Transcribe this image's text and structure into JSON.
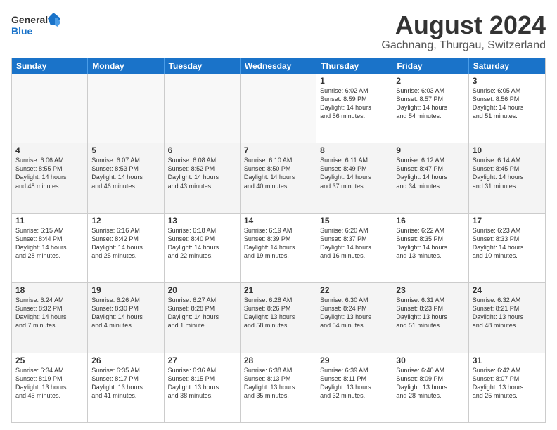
{
  "logo": {
    "line1": "General",
    "line2": "Blue"
  },
  "title": "August 2024",
  "location": "Gachnang, Thurgau, Switzerland",
  "days": [
    "Sunday",
    "Monday",
    "Tuesday",
    "Wednesday",
    "Thursday",
    "Friday",
    "Saturday"
  ],
  "weeks": [
    [
      {
        "day": "",
        "info": "",
        "empty": true
      },
      {
        "day": "",
        "info": "",
        "empty": true
      },
      {
        "day": "",
        "info": "",
        "empty": true
      },
      {
        "day": "",
        "info": "",
        "empty": true
      },
      {
        "day": "1",
        "info": "Sunrise: 6:02 AM\nSunset: 8:59 PM\nDaylight: 14 hours\nand 56 minutes."
      },
      {
        "day": "2",
        "info": "Sunrise: 6:03 AM\nSunset: 8:57 PM\nDaylight: 14 hours\nand 54 minutes."
      },
      {
        "day": "3",
        "info": "Sunrise: 6:05 AM\nSunset: 8:56 PM\nDaylight: 14 hours\nand 51 minutes."
      }
    ],
    [
      {
        "day": "4",
        "info": "Sunrise: 6:06 AM\nSunset: 8:55 PM\nDaylight: 14 hours\nand 48 minutes."
      },
      {
        "day": "5",
        "info": "Sunrise: 6:07 AM\nSunset: 8:53 PM\nDaylight: 14 hours\nand 46 minutes."
      },
      {
        "day": "6",
        "info": "Sunrise: 6:08 AM\nSunset: 8:52 PM\nDaylight: 14 hours\nand 43 minutes."
      },
      {
        "day": "7",
        "info": "Sunrise: 6:10 AM\nSunset: 8:50 PM\nDaylight: 14 hours\nand 40 minutes."
      },
      {
        "day": "8",
        "info": "Sunrise: 6:11 AM\nSunset: 8:49 PM\nDaylight: 14 hours\nand 37 minutes."
      },
      {
        "day": "9",
        "info": "Sunrise: 6:12 AM\nSunset: 8:47 PM\nDaylight: 14 hours\nand 34 minutes."
      },
      {
        "day": "10",
        "info": "Sunrise: 6:14 AM\nSunset: 8:45 PM\nDaylight: 14 hours\nand 31 minutes."
      }
    ],
    [
      {
        "day": "11",
        "info": "Sunrise: 6:15 AM\nSunset: 8:44 PM\nDaylight: 14 hours\nand 28 minutes."
      },
      {
        "day": "12",
        "info": "Sunrise: 6:16 AM\nSunset: 8:42 PM\nDaylight: 14 hours\nand 25 minutes."
      },
      {
        "day": "13",
        "info": "Sunrise: 6:18 AM\nSunset: 8:40 PM\nDaylight: 14 hours\nand 22 minutes."
      },
      {
        "day": "14",
        "info": "Sunrise: 6:19 AM\nSunset: 8:39 PM\nDaylight: 14 hours\nand 19 minutes."
      },
      {
        "day": "15",
        "info": "Sunrise: 6:20 AM\nSunset: 8:37 PM\nDaylight: 14 hours\nand 16 minutes."
      },
      {
        "day": "16",
        "info": "Sunrise: 6:22 AM\nSunset: 8:35 PM\nDaylight: 14 hours\nand 13 minutes."
      },
      {
        "day": "17",
        "info": "Sunrise: 6:23 AM\nSunset: 8:33 PM\nDaylight: 14 hours\nand 10 minutes."
      }
    ],
    [
      {
        "day": "18",
        "info": "Sunrise: 6:24 AM\nSunset: 8:32 PM\nDaylight: 14 hours\nand 7 minutes."
      },
      {
        "day": "19",
        "info": "Sunrise: 6:26 AM\nSunset: 8:30 PM\nDaylight: 14 hours\nand 4 minutes."
      },
      {
        "day": "20",
        "info": "Sunrise: 6:27 AM\nSunset: 8:28 PM\nDaylight: 14 hours\nand 1 minute."
      },
      {
        "day": "21",
        "info": "Sunrise: 6:28 AM\nSunset: 8:26 PM\nDaylight: 13 hours\nand 58 minutes."
      },
      {
        "day": "22",
        "info": "Sunrise: 6:30 AM\nSunset: 8:24 PM\nDaylight: 13 hours\nand 54 minutes."
      },
      {
        "day": "23",
        "info": "Sunrise: 6:31 AM\nSunset: 8:23 PM\nDaylight: 13 hours\nand 51 minutes."
      },
      {
        "day": "24",
        "info": "Sunrise: 6:32 AM\nSunset: 8:21 PM\nDaylight: 13 hours\nand 48 minutes."
      }
    ],
    [
      {
        "day": "25",
        "info": "Sunrise: 6:34 AM\nSunset: 8:19 PM\nDaylight: 13 hours\nand 45 minutes."
      },
      {
        "day": "26",
        "info": "Sunrise: 6:35 AM\nSunset: 8:17 PM\nDaylight: 13 hours\nand 41 minutes."
      },
      {
        "day": "27",
        "info": "Sunrise: 6:36 AM\nSunset: 8:15 PM\nDaylight: 13 hours\nand 38 minutes."
      },
      {
        "day": "28",
        "info": "Sunrise: 6:38 AM\nSunset: 8:13 PM\nDaylight: 13 hours\nand 35 minutes."
      },
      {
        "day": "29",
        "info": "Sunrise: 6:39 AM\nSunset: 8:11 PM\nDaylight: 13 hours\nand 32 minutes."
      },
      {
        "day": "30",
        "info": "Sunrise: 6:40 AM\nSunset: 8:09 PM\nDaylight: 13 hours\nand 28 minutes."
      },
      {
        "day": "31",
        "info": "Sunrise: 6:42 AM\nSunset: 8:07 PM\nDaylight: 13 hours\nand 25 minutes."
      }
    ]
  ]
}
